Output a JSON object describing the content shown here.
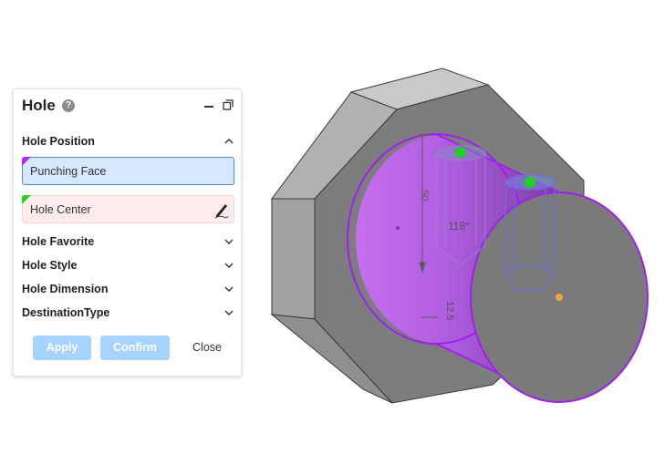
{
  "panel": {
    "title": "Hole",
    "help_symbol": "?",
    "sections": {
      "hole_position": "Hole Position",
      "hole_favorite": "Hole Favorite",
      "hole_style": "Hole Style",
      "hole_dimension": "Hole Dimension",
      "destination_type": "DestinationType"
    },
    "fields": {
      "punching_face": "Punching Face",
      "hole_center": "Hole Center"
    },
    "buttons": {
      "apply": "Apply",
      "confirm": "Confirm",
      "close": "Close"
    }
  },
  "viewport": {
    "dimensions": {
      "depth": "50",
      "angle": "118°",
      "diameter": "12.5"
    }
  },
  "colors": {
    "selection_purple": "#b22af0",
    "point_green": "#1ed31e",
    "point_orange": "#f5a03a",
    "accent_blue": "#4b8fd6",
    "button_disabled_blue": "#a7d3ff",
    "body_gray": "#7d7d7d"
  },
  "icons": [
    "help-icon",
    "minimize-icon",
    "restore-icon",
    "chevron-up-icon",
    "chevron-down-icon",
    "pen-icon"
  ]
}
